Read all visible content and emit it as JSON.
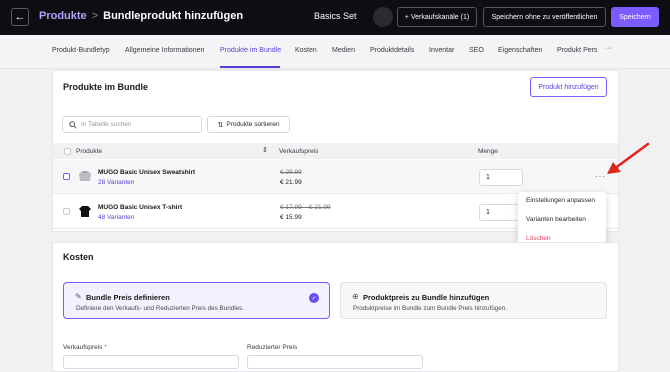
{
  "header": {
    "back_icon": "arrow-left-icon",
    "breadcrumb_root": "Produkte",
    "breadcrumb_sep": ">",
    "page_title": "Bundleprodukt hinzufügen",
    "product_name": "Basics Set",
    "channels_button": "+ Verkaufskanäle (1)",
    "save_draft_button": "Speichern ohne zu veröffentlichen",
    "save_button": "Speichern",
    "accent_color": "#7b5cff"
  },
  "tabs": [
    {
      "label": "Produkt-Bundletyp"
    },
    {
      "label": "Allgemeine Informationen"
    },
    {
      "label": "Produkte im Bundle",
      "active": true
    },
    {
      "label": "Kosten"
    },
    {
      "label": "Medien"
    },
    {
      "label": "Produktdetails"
    },
    {
      "label": "Inventar"
    },
    {
      "label": "SEO"
    },
    {
      "label": "Eigenschaften"
    },
    {
      "label": "Produkt Pers"
    }
  ],
  "tabs_more": "···",
  "bundle": {
    "title": "Produkte im Bundle",
    "add_button": "Produkt hinzufügen",
    "search_placeholder": "In Tabelle suchen",
    "sort_button": "Produkte sortieren",
    "columns": {
      "product": "Produkte",
      "price": "Verkaufspreis",
      "qty": "Menge"
    },
    "rows": [
      {
        "name": "MUGO Basic Unisex Sweatshirt",
        "variants": "28 Varianten",
        "old_price": "€ 29.99",
        "price": "€ 21.99",
        "qty": "1"
      },
      {
        "name": "MUGO Basic Unisex T-shirt",
        "variants": "48 Varianten",
        "old_price": "€ 17.99 – € 21.99",
        "price": "€ 15.99",
        "qty": "1"
      }
    ],
    "row_menu": {
      "items": [
        "Einstellungen anpassen",
        "Varianten bearbeiten",
        "Löschen"
      ],
      "danger_color": "#e0455a"
    }
  },
  "costs": {
    "title": "Kosten",
    "options": [
      {
        "title": "Bundle Preis definieren",
        "desc": "Definiere den Verkaufs- und Reduzierten Preis des Bundles.",
        "selected": true,
        "icon": "pencil-icon"
      },
      {
        "title": "Produktpreis zu Bundle hinzufügen",
        "desc": "Produktpreise im Bundle zum Bundle Preis hinzufügen.",
        "selected": false,
        "icon": "plus-circle-icon"
      }
    ],
    "sale_price_label": "Verkaufspreis",
    "required_mark": "*",
    "reduced_price_label": "Reduzierter Preis"
  },
  "annotation_color": "#e0261c"
}
